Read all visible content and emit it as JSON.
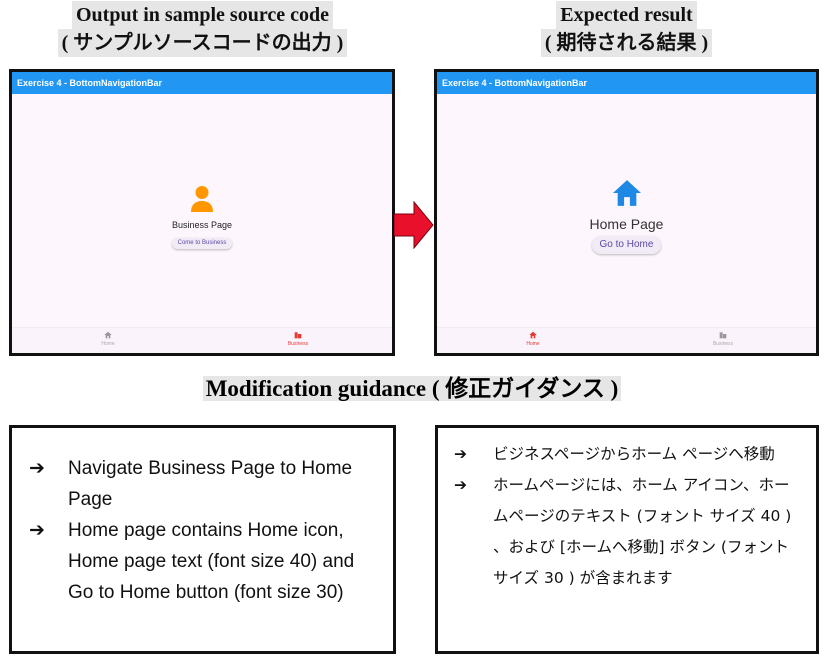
{
  "captions": {
    "left": [
      "Output in sample source code",
      "( サンプルソースコードの出力 )"
    ],
    "right": [
      "Expected result",
      "( 期待される結果 )"
    ]
  },
  "left_screen": {
    "appbar_title": "Exercise 4 - BottomNavigationBar",
    "page_icon": "person-icon",
    "page_text": "Business Page",
    "button_text": "Come to Business",
    "nav": [
      {
        "label": "Home",
        "icon": "home-icon",
        "selected": false
      },
      {
        "label": "Business",
        "icon": "business-icon",
        "selected": true
      }
    ]
  },
  "right_screen": {
    "appbar_title": "Exercise 4 - BottomNavigationBar",
    "page_icon": "home-icon",
    "page_text": "Home Page",
    "button_text": "Go to Home",
    "nav": [
      {
        "label": "Home",
        "icon": "home-icon",
        "selected": true
      },
      {
        "label": "Business",
        "icon": "business-icon",
        "selected": false
      }
    ]
  },
  "colors": {
    "appbar": "#2196f3",
    "person_icon": "#ff9800",
    "home_icon": "#1e88e5",
    "selected_nav": "#e53935",
    "arrow": "#e8102a"
  },
  "guidance": {
    "title": "Modification guidance ( 修正ガイダンス )",
    "en": [
      "Navigate Business Page  to Home Page",
      "Home page contains Home icon, Home page text (font size 40) and Go to Home button (font size 30)"
    ],
    "ja": [
      "ビジネスページからホーム ページへ移動",
      "ホームページには、ホーム アイコン、ホームページのテキスト (フォント サイズ 40 ) 、および [ホームへ移動] ボタン (フォント サイズ 30 ) が含まれます"
    ],
    "bullet": "➔"
  }
}
